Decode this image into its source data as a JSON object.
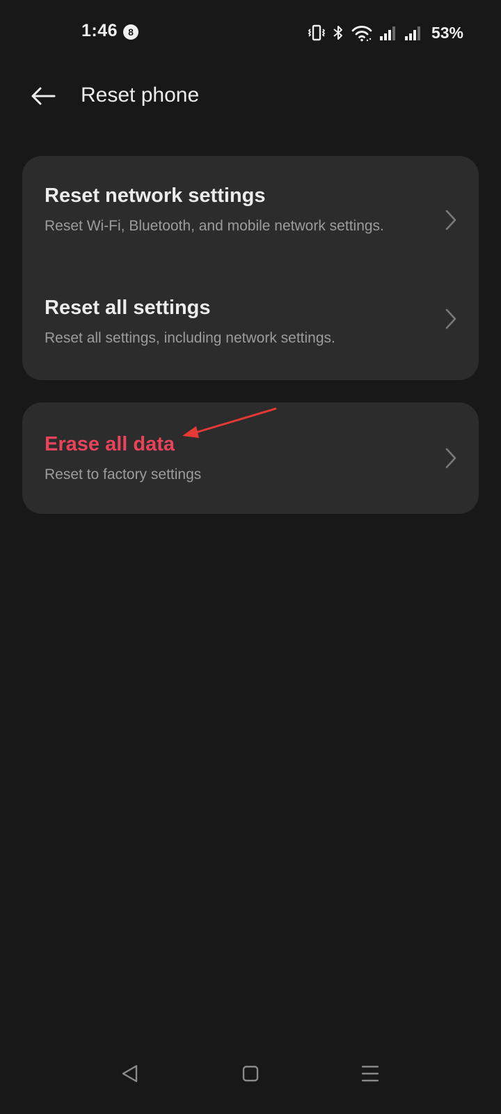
{
  "status_bar": {
    "time": "1:46",
    "notification_count": "8",
    "battery": "53%",
    "icons": [
      "vibrate-icon",
      "bluetooth-icon",
      "wifi-icon",
      "signal-icon",
      "signal-icon",
      "battery-text"
    ]
  },
  "header": {
    "title": "Reset phone",
    "back_icon": "arrow-left-icon"
  },
  "sections": [
    {
      "items": [
        {
          "title": "Reset network settings",
          "subtitle": "Reset Wi-Fi, Bluetooth, and mobile network settings."
        },
        {
          "title": "Reset all settings",
          "subtitle": "Reset all settings, including network settings."
        }
      ]
    },
    {
      "items": [
        {
          "title": "Erase all data",
          "subtitle": "Reset to factory settings",
          "color": "#e8435a"
        }
      ]
    }
  ],
  "nav_bar": {
    "buttons": [
      "back-triangle-icon",
      "home-square-icon",
      "recents-menu-icon"
    ]
  },
  "colors": {
    "background": "#181818",
    "card": "#2c2c2c",
    "danger": "#e8435a",
    "annotation_arrow": "#e53935"
  }
}
